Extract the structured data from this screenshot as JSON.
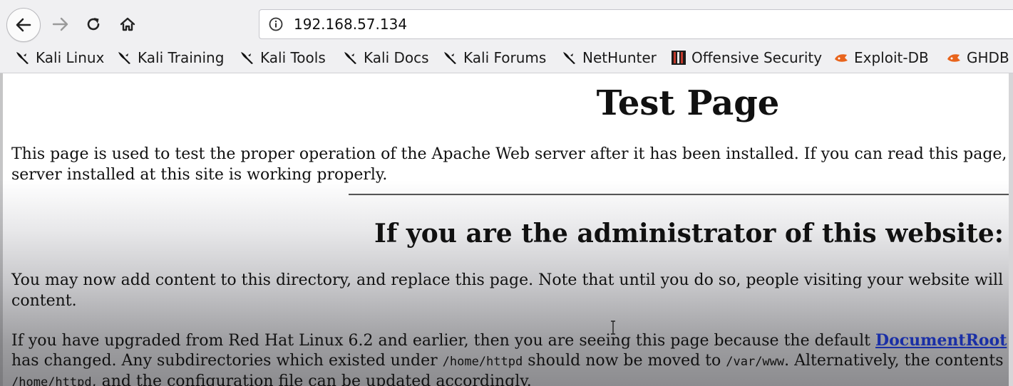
{
  "toolbar": {
    "url": "192.168.57.134",
    "icons": {
      "back": "back-arrow-icon",
      "forward": "forward-arrow-icon",
      "reload": "reload-icon",
      "home": "home-icon",
      "info": "info-icon"
    }
  },
  "bookmarks": [
    {
      "label": "Kali Linux",
      "icon": "kali-dragon-icon"
    },
    {
      "label": "Kali Training",
      "icon": "kali-dragon-icon"
    },
    {
      "label": "Kali Tools",
      "icon": "kali-dragon-icon"
    },
    {
      "label": "Kali Docs",
      "icon": "kali-dragon-icon"
    },
    {
      "label": "Kali Forums",
      "icon": "kali-dragon-icon"
    },
    {
      "label": "NetHunter",
      "icon": "kali-dragon-icon"
    },
    {
      "label": "Offensive Security",
      "icon": "offsec-icon"
    },
    {
      "label": "Exploit-DB",
      "icon": "exploitdb-icon"
    },
    {
      "label": "GHDB",
      "icon": "exploitdb-icon"
    }
  ],
  "page": {
    "title": "Test Page",
    "intro_line1": "This page is used to test the proper operation of the Apache Web server after it has been installed. If you can read this page, it means that the Apache Web",
    "intro_line2": "server installed at this site is working properly.",
    "admin_heading": "If you are the administrator of this website:",
    "admin_p1_line1": "You may now add content to this directory, and replace this page. Note that until you do so, people visiting your website will see this page and not your",
    "admin_p1_line2": "content.",
    "admin_p2_line1_a": "If you have upgraded from Red Hat Linux 6.2 and earlier, then you are seeing this page because the default ",
    "admin_p2_link": "DocumentRoot",
    "admin_p2_line2_a": "has changed. Any subdirectories which existed under ",
    "admin_p2_code1": "/home/httpd",
    "admin_p2_line2_b": " should now be moved to ",
    "admin_p2_code2": "/var/www",
    "admin_p2_line2_c": ". Alternatively, the contents of ",
    "admin_p2_line3_code": "/home/httpd",
    "admin_p2_line3_b": ", and the configuration file can be updated accordingly."
  },
  "colors": {
    "link": "#1a2fa6",
    "toolbar_bg": "#f0f0f2"
  }
}
